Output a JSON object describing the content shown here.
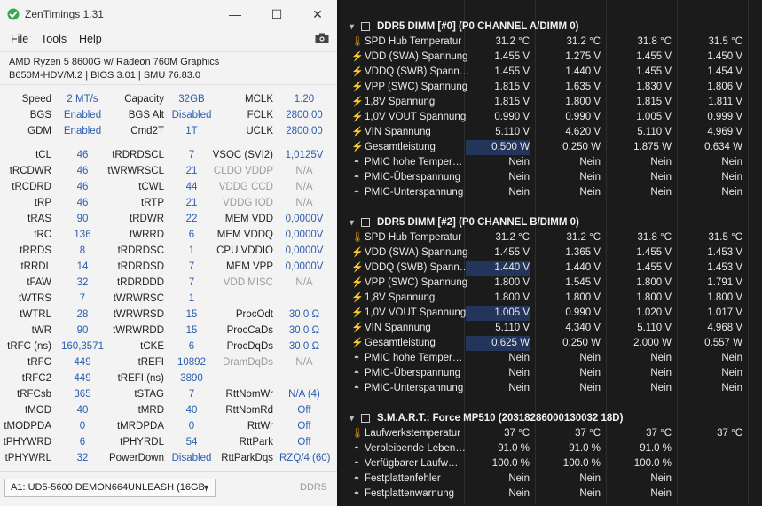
{
  "zentimings": {
    "title": "ZenTimings 1.31",
    "window_buttons": {
      "minimize": "—",
      "maximize": "☐",
      "close": "✕"
    },
    "menu": [
      "File",
      "Tools",
      "Help"
    ],
    "camera_icon": "camera-icon",
    "cpu_line": "AMD Ryzen 5 8600G w/ Radeon 760M Graphics",
    "board_line": "B650M-HDV/M.2 | BIOS 3.01 | SMU 76.83.0",
    "top_rows": [
      [
        {
          "l": "Speed",
          "v": "2 MT/s"
        },
        {
          "l": "Capacity",
          "v": "32GB"
        },
        {
          "l": "MCLK",
          "v": "1.20"
        }
      ],
      [
        {
          "l": "BGS",
          "v": "Enabled"
        },
        {
          "l": "BGS Alt",
          "v": "Disabled"
        },
        {
          "l": "FCLK",
          "v": "2800.00"
        }
      ],
      [
        {
          "l": "GDM",
          "v": "Enabled"
        },
        {
          "l": "Cmd2T",
          "v": "1T"
        },
        {
          "l": "UCLK",
          "v": "2800.00"
        }
      ]
    ],
    "timing_rows": [
      [
        {
          "l": "tCL",
          "v": "46"
        },
        {
          "l": "tRDRDSCL",
          "v": "7"
        },
        {
          "l": "VSOC (SVI2)",
          "v": "1,0125V"
        }
      ],
      [
        {
          "l": "tRCDWR",
          "v": "46"
        },
        {
          "l": "tWRWRSCL",
          "v": "21"
        },
        {
          "l": "CLDO VDDP",
          "v": "N/A",
          "dis": true
        }
      ],
      [
        {
          "l": "tRCDRD",
          "v": "46"
        },
        {
          "l": "tCWL",
          "v": "44"
        },
        {
          "l": "VDDG CCD",
          "v": "N/A",
          "dis": true
        }
      ],
      [
        {
          "l": "tRP",
          "v": "46"
        },
        {
          "l": "tRTP",
          "v": "21"
        },
        {
          "l": "VDDG IOD",
          "v": "N/A",
          "dis": true
        }
      ],
      [
        {
          "l": "tRAS",
          "v": "90"
        },
        {
          "l": "tRDWR",
          "v": "22"
        },
        {
          "l": "MEM VDD",
          "v": "0,0000V"
        }
      ],
      [
        {
          "l": "tRC",
          "v": "136"
        },
        {
          "l": "tWRRD",
          "v": "6"
        },
        {
          "l": "MEM VDDQ",
          "v": "0,0000V"
        }
      ],
      [
        {
          "l": "tRRDS",
          "v": "8"
        },
        {
          "l": "tRDRDSC",
          "v": "1"
        },
        {
          "l": "CPU VDDIO",
          "v": "0,0000V"
        }
      ],
      [
        {
          "l": "tRRDL",
          "v": "14"
        },
        {
          "l": "tRDRDSD",
          "v": "7"
        },
        {
          "l": "MEM VPP",
          "v": "0,0000V"
        }
      ],
      [
        {
          "l": "tFAW",
          "v": "32"
        },
        {
          "l": "tRDRDDD",
          "v": "7"
        },
        {
          "l": "VDD MISC",
          "v": "N/A",
          "dis": true
        }
      ],
      [
        {
          "l": "tWTRS",
          "v": "7"
        },
        {
          "l": "tWRWRSC",
          "v": "1"
        },
        {
          "l": "",
          "v": ""
        }
      ],
      [
        {
          "l": "tWTRL",
          "v": "28"
        },
        {
          "l": "tWRWRSD",
          "v": "15"
        },
        {
          "l": "ProcOdt",
          "v": "30.0 Ω"
        }
      ],
      [
        {
          "l": "tWR",
          "v": "90"
        },
        {
          "l": "tWRWRDD",
          "v": "15"
        },
        {
          "l": "ProcCaDs",
          "v": "30.0 Ω"
        }
      ],
      [
        {
          "l": "tRFC (ns)",
          "v": "160,3571"
        },
        {
          "l": "tCKE",
          "v": "6"
        },
        {
          "l": "ProcDqDs",
          "v": "30.0 Ω"
        }
      ],
      [
        {
          "l": "tRFC",
          "v": "449"
        },
        {
          "l": "tREFI",
          "v": "10892"
        },
        {
          "l": "DramDqDs",
          "v": "N/A",
          "dis": true
        }
      ],
      [
        {
          "l": "tRFC2",
          "v": "449"
        },
        {
          "l": "tREFI (ns)",
          "v": "3890"
        },
        {
          "l": "",
          "v": ""
        }
      ],
      [
        {
          "l": "tRFCsb",
          "v": "365"
        },
        {
          "l": "tSTAG",
          "v": "7"
        },
        {
          "l": "RttNomWr",
          "v": "N/A (4)"
        }
      ],
      [
        {
          "l": "tMOD",
          "v": "40"
        },
        {
          "l": "tMRD",
          "v": "40"
        },
        {
          "l": "RttNomRd",
          "v": "Off"
        }
      ],
      [
        {
          "l": "tMODPDA",
          "v": "0"
        },
        {
          "l": "tMRDPDA",
          "v": "0"
        },
        {
          "l": "RttWr",
          "v": "Off"
        }
      ],
      [
        {
          "l": "tPHYWRD",
          "v": "6"
        },
        {
          "l": "tPHYRDL",
          "v": "54"
        },
        {
          "l": "RttPark",
          "v": "Off"
        }
      ],
      [
        {
          "l": "tPHYWRL",
          "v": "32"
        },
        {
          "l": "PowerDown",
          "v": "Disabled"
        },
        {
          "l": "RttParkDqs",
          "v": "RZQ/4 (60)"
        }
      ]
    ],
    "module_select": "A1: UD5-5600 DEMON664UNLEASH (16GB,",
    "mem_type": "DDR5"
  },
  "monitor": {
    "top_cut_text": "... (AMD ...)",
    "sections": [
      {
        "header": "DDR5 DIMM [#0] (P0 CHANNEL A/DIMM 0)",
        "rows": [
          {
            "icon": "thermometer-icon",
            "label": "SPD Hub Temperatur",
            "vals": [
              "31.2 °C",
              "31.2 °C",
              "31.8 °C",
              "31.5 °C"
            ],
            "hl": []
          },
          {
            "icon": "bolt-icon",
            "label": "VDD (SWA) Spannung",
            "vals": [
              "1.455 V",
              "1.275 V",
              "1.455 V",
              "1.450 V"
            ],
            "hl": []
          },
          {
            "icon": "bolt-icon",
            "label": "VDDQ (SWB) Spann…",
            "vals": [
              "1.455 V",
              "1.440 V",
              "1.455 V",
              "1.454 V"
            ],
            "hl": []
          },
          {
            "icon": "bolt-icon",
            "label": "VPP (SWC) Spannung",
            "vals": [
              "1.815 V",
              "1.635 V",
              "1.830 V",
              "1.806 V"
            ],
            "hl": []
          },
          {
            "icon": "bolt-icon",
            "label": "1,8V Spannung",
            "vals": [
              "1.815 V",
              "1.800 V",
              "1.815 V",
              "1.811 V"
            ],
            "hl": []
          },
          {
            "icon": "bolt-icon",
            "label": "1,0V VOUT Spannung",
            "vals": [
              "0.990 V",
              "0.990 V",
              "1.005 V",
              "0.999 V"
            ],
            "hl": []
          },
          {
            "icon": "bolt-icon",
            "label": "VIN Spannung",
            "vals": [
              "5.110 V",
              "4.620 V",
              "5.110 V",
              "4.969 V"
            ],
            "hl": []
          },
          {
            "icon": "bolt-icon",
            "label": "Gesamtleistung",
            "vals": [
              "0.500 W",
              "0.250 W",
              "1.875 W",
              "0.634 W"
            ],
            "hl": [
              0
            ]
          },
          {
            "icon": "circle-icon",
            "label": "PMIC hohe Temper…",
            "vals": [
              "Nein",
              "Nein",
              "Nein",
              "Nein"
            ],
            "hl": []
          },
          {
            "icon": "circle-icon",
            "label": "PMIC-Überspannung",
            "vals": [
              "Nein",
              "Nein",
              "Nein",
              "Nein"
            ],
            "hl": []
          },
          {
            "icon": "circle-icon",
            "label": "PMIC-Unterspannung",
            "vals": [
              "Nein",
              "Nein",
              "Nein",
              "Nein"
            ],
            "hl": []
          }
        ]
      },
      {
        "header": "DDR5 DIMM [#2] (P0 CHANNEL B/DIMM 0)",
        "rows": [
          {
            "icon": "thermometer-icon",
            "label": "SPD Hub Temperatur",
            "vals": [
              "31.2 °C",
              "31.2 °C",
              "31.8 °C",
              "31.5 °C"
            ],
            "hl": []
          },
          {
            "icon": "bolt-icon",
            "label": "VDD (SWA) Spannung",
            "vals": [
              "1.455 V",
              "1.365 V",
              "1.455 V",
              "1.453 V"
            ],
            "hl": []
          },
          {
            "icon": "bolt-icon",
            "label": "VDDQ (SWB) Spann…",
            "vals": [
              "1.440 V",
              "1.440 V",
              "1.455 V",
              "1.453 V"
            ],
            "hl": [
              0
            ]
          },
          {
            "icon": "bolt-icon",
            "label": "VPP (SWC) Spannung",
            "vals": [
              "1.800 V",
              "1.545 V",
              "1.800 V",
              "1.791 V"
            ],
            "hl": []
          },
          {
            "icon": "bolt-icon",
            "label": "1,8V Spannung",
            "vals": [
              "1.800 V",
              "1.800 V",
              "1.800 V",
              "1.800 V"
            ],
            "hl": []
          },
          {
            "icon": "bolt-icon",
            "label": "1,0V VOUT Spannung",
            "vals": [
              "1.005 V",
              "0.990 V",
              "1.020 V",
              "1.017 V"
            ],
            "hl": [
              0
            ]
          },
          {
            "icon": "bolt-icon",
            "label": "VIN Spannung",
            "vals": [
              "5.110 V",
              "4.340 V",
              "5.110 V",
              "4.968 V"
            ],
            "hl": []
          },
          {
            "icon": "bolt-icon",
            "label": "Gesamtleistung",
            "vals": [
              "0.625 W",
              "0.250 W",
              "2.000 W",
              "0.557 W"
            ],
            "hl": [
              0
            ]
          },
          {
            "icon": "circle-icon",
            "label": "PMIC hohe Temper…",
            "vals": [
              "Nein",
              "Nein",
              "Nein",
              "Nein"
            ],
            "hl": []
          },
          {
            "icon": "circle-icon",
            "label": "PMIC-Überspannung",
            "vals": [
              "Nein",
              "Nein",
              "Nein",
              "Nein"
            ],
            "hl": []
          },
          {
            "icon": "circle-icon",
            "label": "PMIC-Unterspannung",
            "vals": [
              "Nein",
              "Nein",
              "Nein",
              "Nein"
            ],
            "hl": []
          }
        ]
      },
      {
        "header": "S.M.A.R.T.: Force MP510 (20318286000130032 18D)",
        "rows": [
          {
            "icon": "thermometer-icon",
            "label": "Laufwerkstemperatur",
            "vals": [
              "37 °C",
              "37 °C",
              "37 °C",
              "37 °C"
            ],
            "hl": []
          },
          {
            "icon": "circle-icon",
            "label": "Verbleibende Leben…",
            "vals": [
              "91.0 %",
              "91.0 %",
              "91.0 %",
              ""
            ],
            "hl": []
          },
          {
            "icon": "circle-icon",
            "label": "Verfügbarer Laufw…",
            "vals": [
              "100.0 %",
              "100.0 %",
              "100.0 %",
              ""
            ],
            "hl": []
          },
          {
            "icon": "circle-icon",
            "label": "Festplattenfehler",
            "vals": [
              "Nein",
              "Nein",
              "Nein",
              ""
            ],
            "hl": []
          },
          {
            "icon": "circle-icon",
            "label": "Festplattenwarnung",
            "vals": [
              "Nein",
              "Nein",
              "Nein",
              ""
            ],
            "hl": []
          }
        ]
      }
    ]
  }
}
